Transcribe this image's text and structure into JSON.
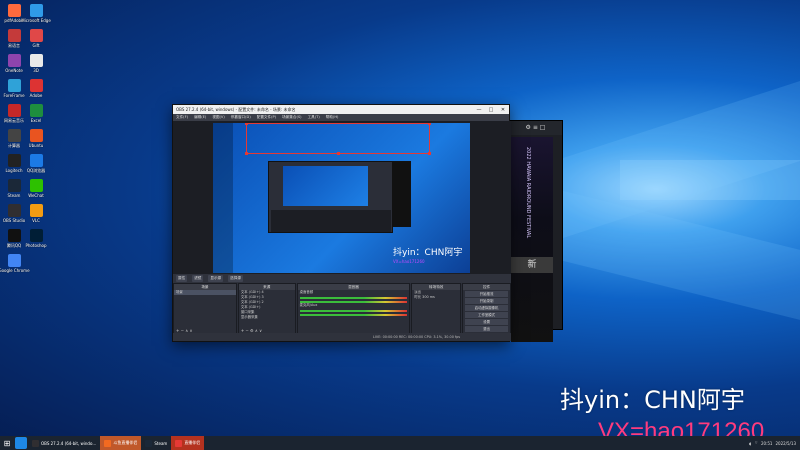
{
  "desktop": {
    "icons": [
      {
        "label": "pdfAdobe",
        "color": "#ff6a3d"
      },
      {
        "label": "Microsoft Edge",
        "color": "#2f9ae8"
      },
      {
        "label": "易语言",
        "color": "#c43a3a"
      },
      {
        "label": "Gift",
        "color": "#e04848"
      },
      {
        "label": "OneNote",
        "color": "#8e44ad"
      },
      {
        "label": "3D",
        "color": "#e9e9e9"
      },
      {
        "label": "ForeFrame",
        "color": "#2fa2d8"
      },
      {
        "label": "Adobe",
        "color": "#d33"
      },
      {
        "label": "网易云音乐",
        "color": "#c62828"
      },
      {
        "label": "Excel",
        "color": "#1e8e3e"
      },
      {
        "label": "计算器",
        "color": "#444"
      },
      {
        "label": "Ubuntu",
        "color": "#e95420"
      },
      {
        "label": "Logitech",
        "color": "#222"
      },
      {
        "label": "QQ浏览器",
        "color": "#1c7ae6"
      },
      {
        "label": "Steam",
        "color": "#1b2838"
      },
      {
        "label": "WeChat",
        "color": "#2dc100"
      },
      {
        "label": "OBS Studio",
        "color": "#302e31"
      },
      {
        "label": "VLC",
        "color": "#f39c12"
      },
      {
        "label": "腾讯QQ",
        "color": "#111"
      },
      {
        "label": "Photoshop",
        "color": "#001e36"
      },
      {
        "label": "Google Chrome",
        "color": "#4285f4"
      }
    ]
  },
  "obs": {
    "title": "OBS 27.2.4 (64-bit, windows) - 配置文件: 未命名 - 场景: 未命名",
    "menu": [
      "文件(F)",
      "编辑(E)",
      "视图(V)",
      "停靠窗口(D)",
      "配置文件(P)",
      "场景集合(S)",
      "工具(T)",
      "帮助(H)"
    ],
    "preview_watermark": "抖yin：CHN阿宇",
    "preview_watermark_small": "VX=hao171260",
    "toolbar": [
      "属性",
      "滤镜",
      "显示源",
      "选择源"
    ],
    "docks": {
      "scenes": {
        "title": "场景",
        "items": [
          "场景"
        ]
      },
      "sources": {
        "title": "来源",
        "items": [
          "文本 (GDI+) 4",
          "文本 (GDI+) 3",
          "文本 (GDI+) 2",
          "文本 (GDI+)",
          "窗口采集",
          "显示器采集"
        ]
      },
      "mixer": {
        "title": "混音器",
        "items": [
          "桌面音频",
          "麦克风/Aux"
        ]
      },
      "transitions": {
        "title": "转场特效",
        "items": [
          "淡出",
          "时长 300 ms"
        ]
      },
      "controls": {
        "title": "控件",
        "buttons": [
          "开始推流",
          "开始录制",
          "启动虚拟摄像机",
          "工作室模式",
          "设置",
          "退出"
        ]
      }
    },
    "status": "LIVE: 00:00:00   REC: 00:00:00   CPU: 3.1%, 30.00 fps"
  },
  "game_window": {
    "vertical_text": "2022 HAWAIA RAIDROUND FESTIVAL",
    "cta": "新"
  },
  "watermark": {
    "line1": "抖yin：CHN阿宇",
    "line2": "VX=hao171260"
  },
  "taskbar": {
    "tasks": [
      {
        "label": "OBS 27.2.4 (64-bit, windo…",
        "color": "#302e31"
      },
      {
        "label": "斗鱼直播伴侣",
        "color": "#f26a21"
      },
      {
        "label": "Steam",
        "color": "#1b2838"
      },
      {
        "label": "直播伴侣",
        "color": "#e53935"
      }
    ],
    "tray_time": "20:51",
    "tray_date": "2022/5/13"
  }
}
